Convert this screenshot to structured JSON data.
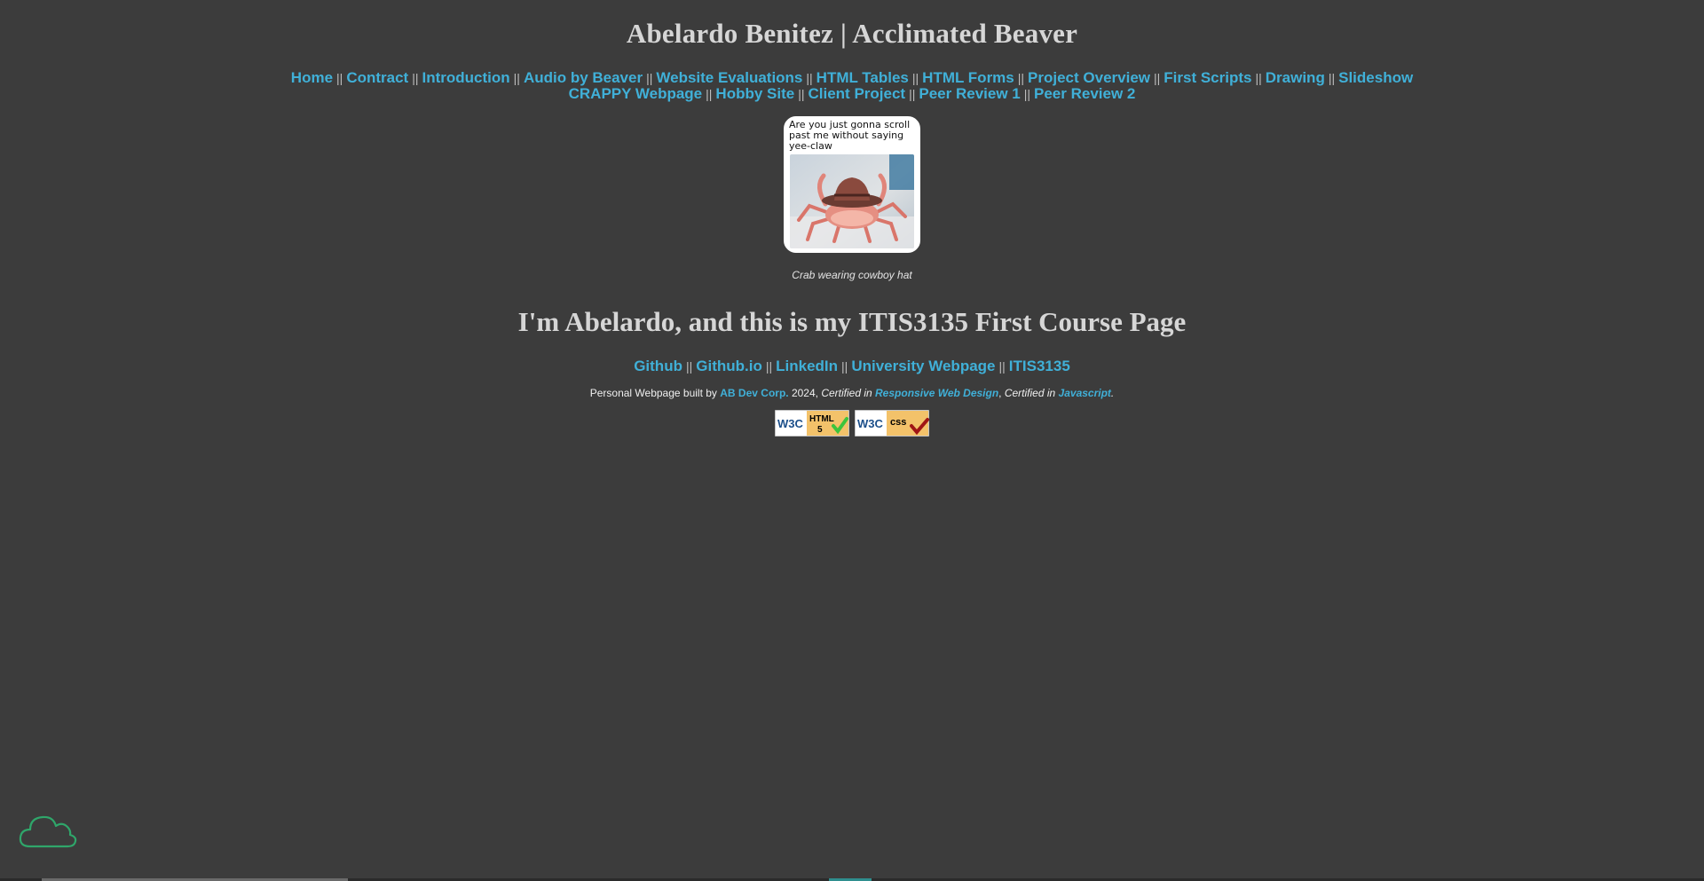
{
  "header": {
    "title": "Abelardo Benitez | Acclimated Beaver"
  },
  "nav": {
    "separator": "||",
    "row1": [
      {
        "label": "Home"
      },
      {
        "label": "Contract"
      },
      {
        "label": "Introduction"
      },
      {
        "label": "Audio by Beaver"
      },
      {
        "label": "Website Evaluations"
      },
      {
        "label": "HTML Tables"
      },
      {
        "label": "HTML Forms"
      },
      {
        "label": "Project Overview"
      },
      {
        "label": "First Scripts"
      },
      {
        "label": "Drawing"
      },
      {
        "label": "Slideshow"
      }
    ],
    "row2": [
      {
        "label": "CRAPPY Webpage"
      },
      {
        "label": "Hobby Site"
      },
      {
        "label": "Client Project"
      },
      {
        "label": "Peer Review 1"
      },
      {
        "label": "Peer Review 2"
      }
    ]
  },
  "figure": {
    "meme_text": "Are you just gonna scroll past me without saying yee-claw",
    "caption": "Crab wearing cowboy hat"
  },
  "main": {
    "heading": "I'm Abelardo, and this is my ITIS3135 First Course Page"
  },
  "social": {
    "links": [
      {
        "label": "Github"
      },
      {
        "label": "Github.io"
      },
      {
        "label": "LinkedIn"
      },
      {
        "label": "University Webpage"
      },
      {
        "label": "ITIS3135"
      }
    ]
  },
  "footer": {
    "prefix": "Personal Webpage built by ",
    "company": "AB Dev Corp.",
    "year": " 2024, ",
    "cert1_prefix": "Certified in ",
    "cert1": "Responsive Web Design",
    "comma": ", ",
    "cert2_prefix": "Certified in ",
    "cert2": "Javascript",
    "end": "."
  },
  "badges": {
    "w3c": "W3C",
    "html_label": "HTML",
    "html_version": "5",
    "css_label": "css"
  },
  "colors": {
    "background": "#3c3c3c",
    "link": "#40b0d8",
    "heading": "#d6d6d6",
    "cloud_icon": "#2fa66a"
  }
}
